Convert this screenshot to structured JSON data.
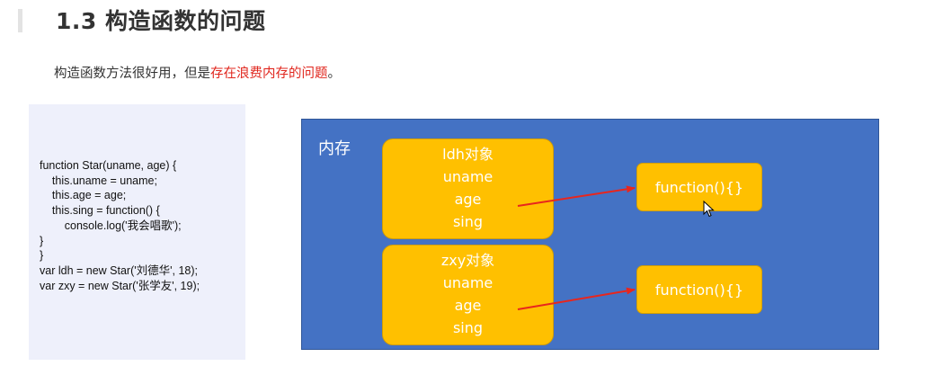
{
  "title": "1.3 构造函数的问题",
  "subtitle": {
    "prefix": "构造函数方法很好用，但是",
    "highlight": "存在浪费内存的问题",
    "suffix": "。"
  },
  "code_lines": [
    "function Star(uname, age) {",
    "    this.uname = uname;",
    "    this.age = age;",
    "    this.sing = function() {",
    "        console.log('我会唱歌');",
    "}",
    "}",
    "var ldh = new Star('刘德华', 18);",
    "var zxy = new Star('张学友', 19);"
  ],
  "memory": {
    "label": "内存",
    "objects": [
      {
        "name": "ldh对象",
        "props": [
          "uname",
          "age",
          "sing"
        ],
        "target": "function(){}"
      },
      {
        "name": "zxy对象",
        "props": [
          "uname",
          "age",
          "sing"
        ],
        "target": "function(){}"
      }
    ]
  },
  "colors": {
    "memory_bg": "#4472c4",
    "box_fill": "#ffc000",
    "arrow": "#e8261d",
    "highlight_text": "#e0261d"
  }
}
